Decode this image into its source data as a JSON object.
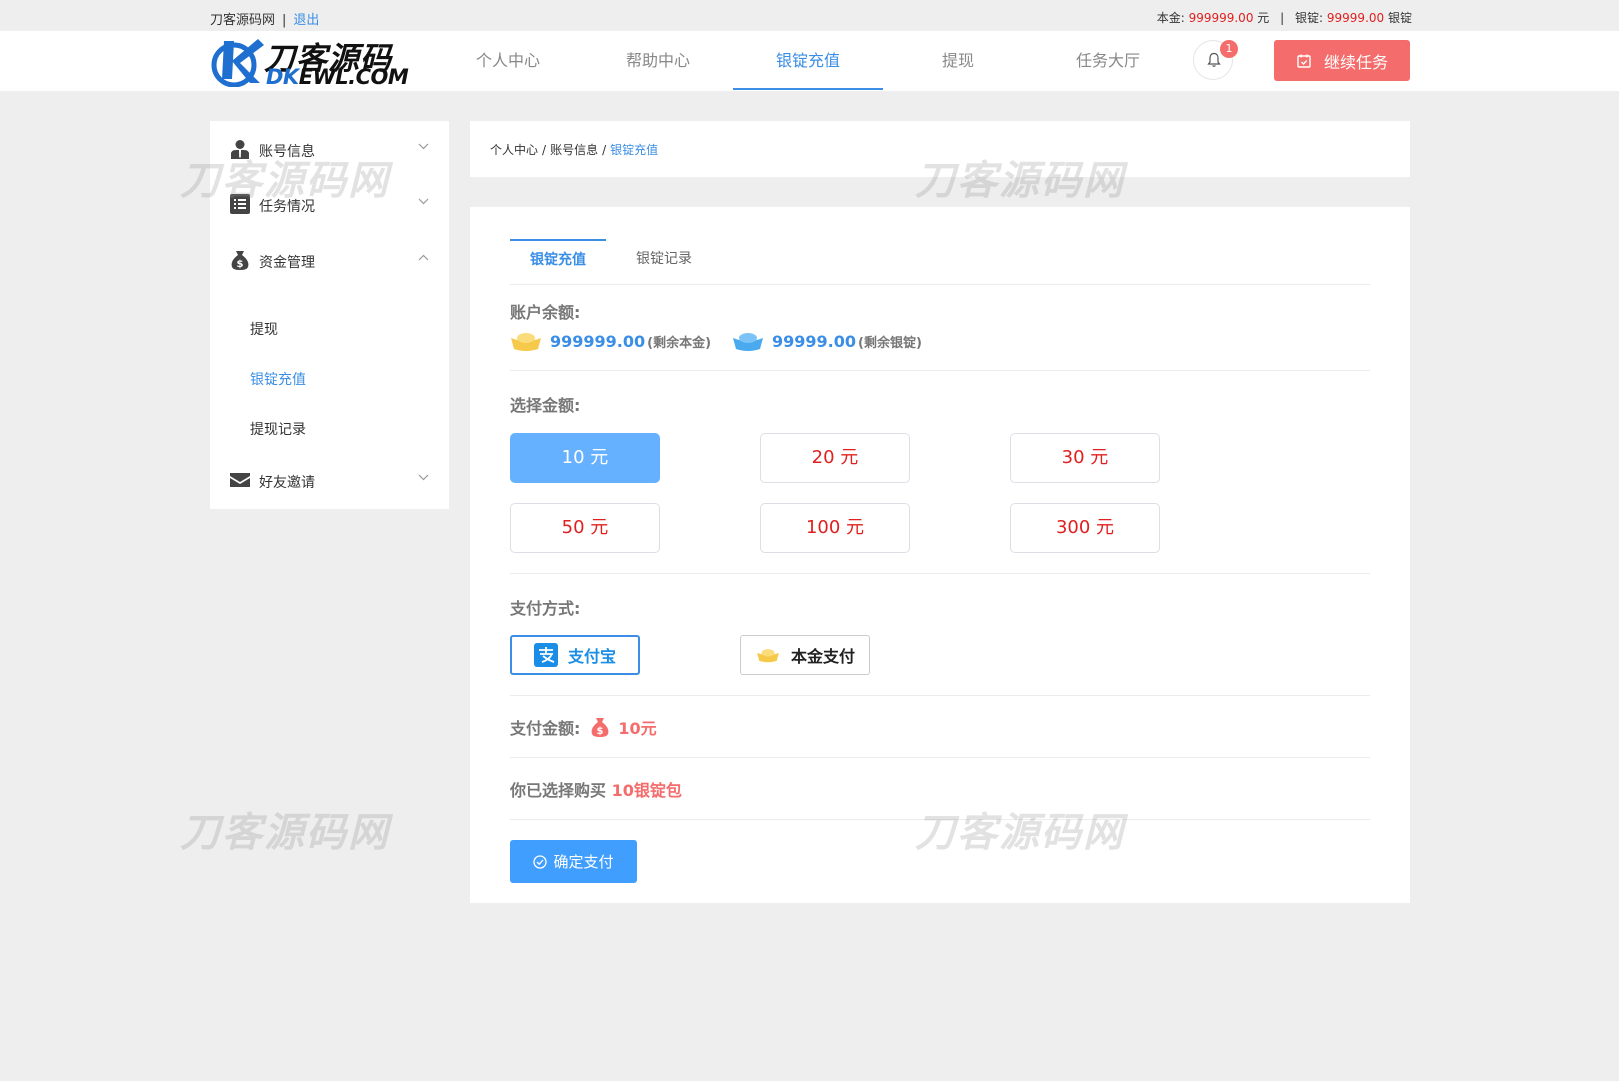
{
  "topbar": {
    "site_name": "刀客源码网",
    "separator": "|",
    "logout": "退出",
    "principal_label": "本金:",
    "principal_value": "999999.00",
    "principal_unit": "元",
    "silver_label": "银锭:",
    "silver_value": "99999.00",
    "silver_unit": "银锭"
  },
  "logo": {
    "cn": "刀客源码",
    "en_k": "DK",
    "en_rest": "EWL.COM"
  },
  "nav": {
    "items": [
      {
        "label": "个人中心"
      },
      {
        "label": "帮助中心"
      },
      {
        "label": "银锭充值"
      },
      {
        "label": "提现"
      },
      {
        "label": "任务大厅"
      }
    ],
    "active_index": 2
  },
  "notifications": {
    "count": "1"
  },
  "continue_task": {
    "label": "继续任务"
  },
  "sidebar": {
    "menus": [
      {
        "label": "账号信息",
        "icon": "user-icon",
        "expanded": false
      },
      {
        "label": "任务情况",
        "icon": "list-icon",
        "expanded": false
      },
      {
        "label": "资金管理",
        "icon": "money-bag-icon",
        "expanded": true
      },
      {
        "label": "好友邀请",
        "icon": "mail-icon",
        "expanded": false
      }
    ],
    "submenu": [
      {
        "label": "提现"
      },
      {
        "label": "银锭充值"
      },
      {
        "label": "提现记录"
      }
    ],
    "active_sub": 1
  },
  "watermark": "刀客源码网",
  "breadcrumb": {
    "items": [
      "个人中心",
      "账号信息",
      "银锭充值"
    ],
    "separator": "/"
  },
  "tabs": [
    {
      "label": "银锭充值"
    },
    {
      "label": "银锭记录"
    }
  ],
  "balance": {
    "label": "账户余额:",
    "principal": "999999.00",
    "principal_note": "(剩余本金)",
    "silver": "99999.00",
    "silver_note": "(剩余银锭)"
  },
  "amount": {
    "label": "选择金额:",
    "options": [
      "10 元",
      "20 元",
      "30 元",
      "50 元",
      "100 元",
      "300 元"
    ],
    "selected_index": 0
  },
  "payment": {
    "label": "支付方式:",
    "alipay": "支付宝",
    "balance_pay": "本金支付"
  },
  "pay_amount": {
    "label": "支付金额:",
    "value": "10元"
  },
  "chosen": {
    "prefix": "你已选择购买",
    "value": "10银锭包"
  },
  "confirm": {
    "label": "确定支付"
  },
  "colors": {
    "accent": "#3a8ee6",
    "danger": "#f56c6c",
    "price_red": "#e02020",
    "selected_amount": "#66b1ff",
    "background": "#eeeeee"
  }
}
